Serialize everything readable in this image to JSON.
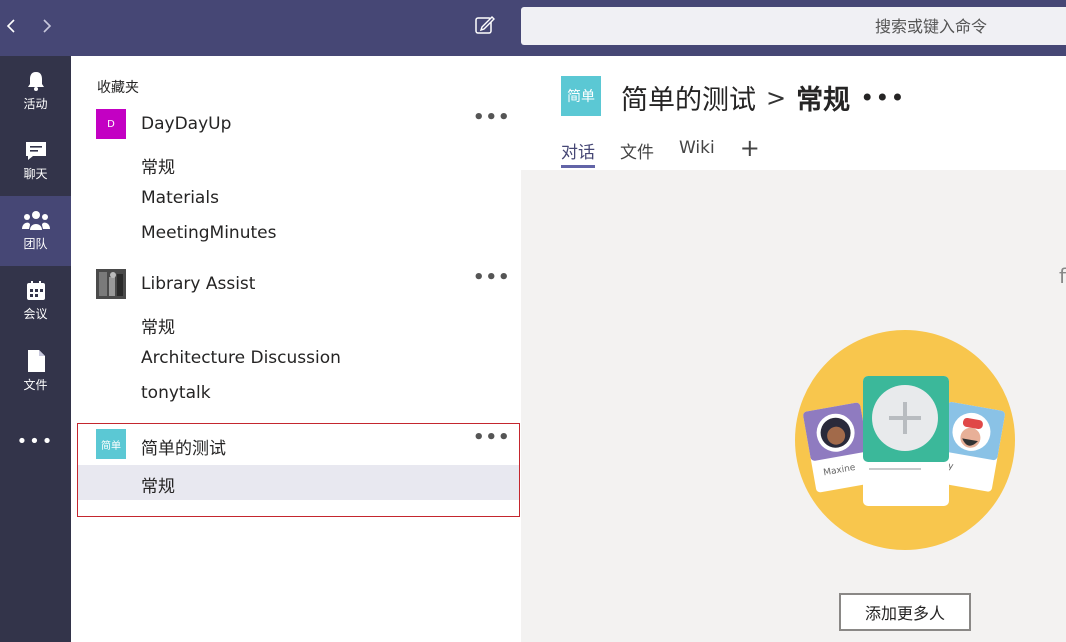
{
  "search": {
    "placeholder": "搜索或键入命令"
  },
  "rail": [
    {
      "label": "活动",
      "icon": "bell-icon"
    },
    {
      "label": "聊天",
      "icon": "chat-icon"
    },
    {
      "label": "团队",
      "icon": "teams-icon",
      "active": true
    },
    {
      "label": "会议",
      "icon": "calendar-icon"
    },
    {
      "label": "文件",
      "icon": "file-icon"
    }
  ],
  "rail_more": "•••",
  "panel": {
    "title": "收藏夹",
    "teams": [
      {
        "name": "DayDayUp",
        "avatar": "D",
        "avatar_color": "#c300c3",
        "channels": [
          "常规",
          "Materials",
          "MeetingMinutes"
        ]
      },
      {
        "name": "Library Assist",
        "avatar": "",
        "avatar_color": "#3a3a3a",
        "channels": [
          "常规",
          "Architecture Discussion",
          "tonytalk"
        ]
      },
      {
        "name": "简单的测试",
        "avatar": "简单",
        "avatar_color": "#5bc8d4",
        "channels": [
          "常规"
        ]
      }
    ],
    "more": "•••"
  },
  "main": {
    "avatar": "简单",
    "team": "简单的测试",
    "separator": ">",
    "channel": "常规",
    "more": "•••",
    "tabs": [
      "对话",
      "文件",
      "Wiki"
    ],
    "tab_add": "+",
    "cut_text": "f",
    "card_left_name": "Maxine",
    "card_right_name": "ky",
    "add_button": "添加更多人"
  },
  "colors": {
    "topbar": "#464775",
    "rail": "#33344a",
    "accent": "#6264a7",
    "highlight": "#c4262e"
  }
}
